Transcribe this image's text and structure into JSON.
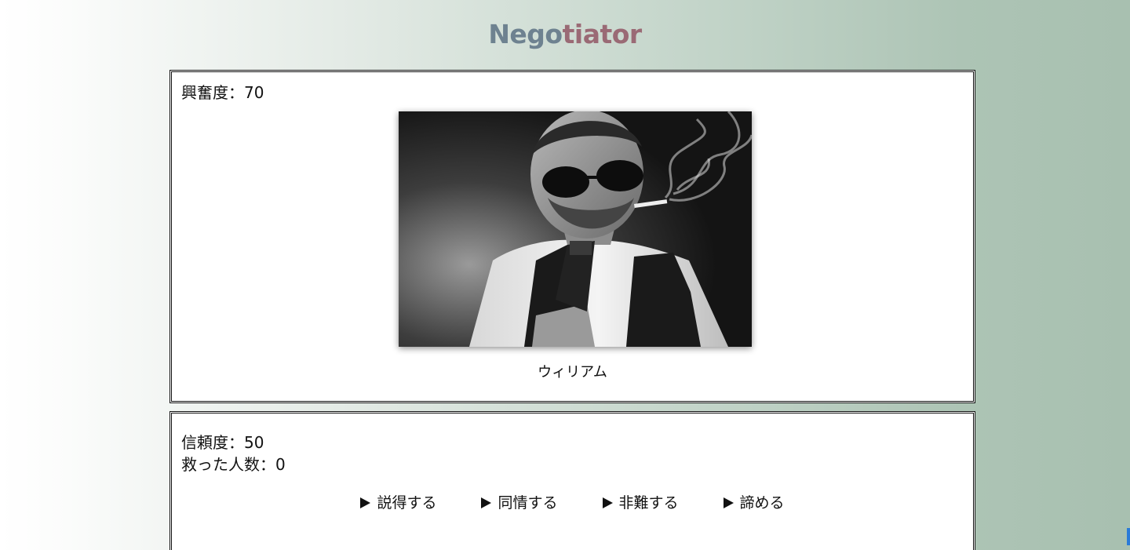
{
  "header": {
    "title_part1": "Nego",
    "title_part2": "tiator"
  },
  "opponent": {
    "excitement_label": "興奮度：",
    "excitement_value": "70",
    "name": "ウィリアム",
    "portrait_alt": "man with sunglasses, cigarette and pistol"
  },
  "player": {
    "trust_label": "信頼度：",
    "trust_value": "50",
    "saved_label": "救った人数：",
    "saved_value": "0"
  },
  "actions": [
    {
      "label": "説得する",
      "icon": "play-arrow-icon"
    },
    {
      "label": "同情する",
      "icon": "play-arrow-icon"
    },
    {
      "label": "非難する",
      "icon": "play-arrow-icon"
    },
    {
      "label": "諦める",
      "icon": "play-arrow-icon"
    }
  ],
  "colors": {
    "title_part1": "#6e8290",
    "title_part2": "#9a6a75",
    "background_start": "#ffffff",
    "background_end": "#a8c0b0"
  }
}
